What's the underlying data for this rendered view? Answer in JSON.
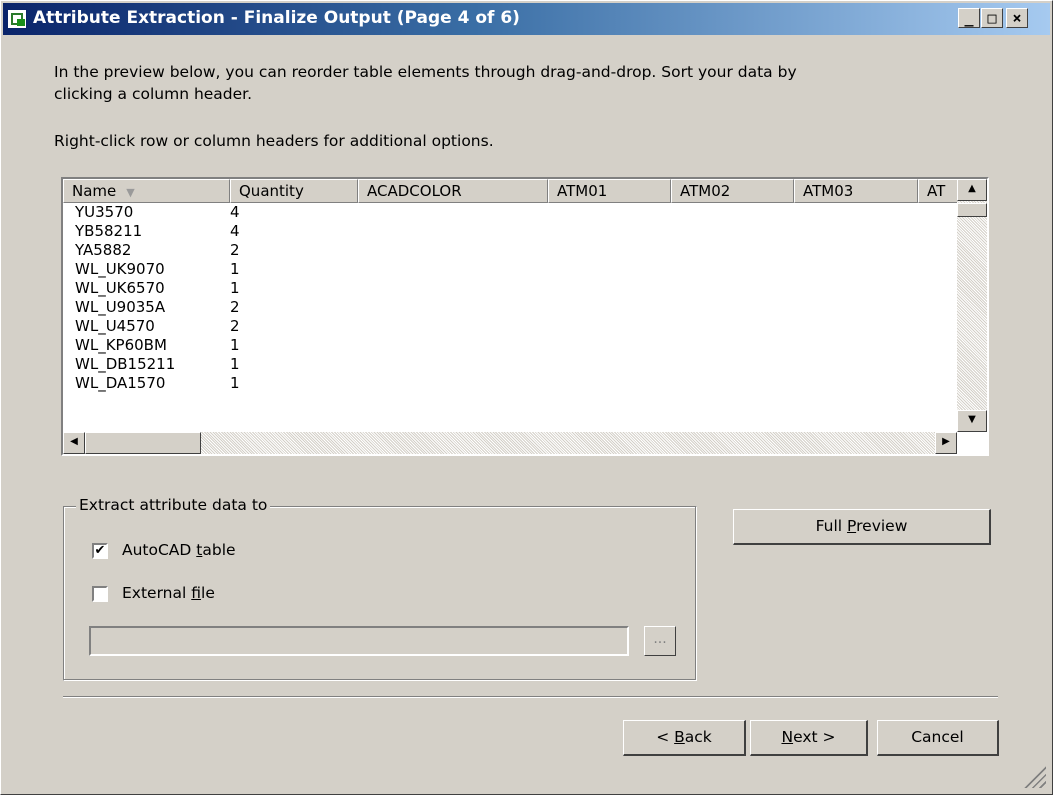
{
  "window": {
    "title": "Attribute Extraction - Finalize Output (Page 4 of 6)",
    "minimize_glyph": "_",
    "maximize_glyph": "□",
    "close_glyph": "×"
  },
  "instructions": {
    "line1": "In the preview below, you can reorder table elements through drag-and-drop. Sort your data by",
    "line2": "clicking a column header.",
    "line3": "Right-click row or column headers for additional options."
  },
  "table": {
    "columns": [
      "Name",
      "Quantity",
      "ACADCOLOR",
      "ATM01",
      "ATM02",
      "ATM03",
      "AT"
    ],
    "sort_indicator": "▼",
    "rows": [
      {
        "name": "YU3570",
        "quantity": "4"
      },
      {
        "name": "YB58211",
        "quantity": "4"
      },
      {
        "name": "YA5882",
        "quantity": "2"
      },
      {
        "name": "WL_UK9070",
        "quantity": "1"
      },
      {
        "name": "WL_UK6570",
        "quantity": "1"
      },
      {
        "name": "WL_U9035A",
        "quantity": "2"
      },
      {
        "name": "WL_U4570",
        "quantity": "2"
      },
      {
        "name": "WL_KP60BM",
        "quantity": "1"
      },
      {
        "name": "WL_DB15211",
        "quantity": "1"
      },
      {
        "name": "WL_DA1570",
        "quantity": "1"
      }
    ]
  },
  "extract": {
    "legend": "Extract attribute data to",
    "autocad_table": {
      "pre": "AutoCAD ",
      "key": "t",
      "post": "able",
      "checked": true
    },
    "external_file": {
      "pre": "External ",
      "key": "f",
      "post": "ile",
      "checked": false
    },
    "path_value": "",
    "browse_label": "..."
  },
  "buttons": {
    "full_preview": {
      "pre": "Full ",
      "key": "P",
      "post": "review"
    },
    "back": {
      "pre": "< ",
      "key": "B",
      "post": "ack"
    },
    "next": {
      "pre": "",
      "key": "N",
      "post": "ext >"
    },
    "cancel": "Cancel"
  },
  "icons": {
    "scroll_up": "▲",
    "scroll_down": "▼",
    "scroll_left": "◀",
    "scroll_right": "▶",
    "check": "✔"
  }
}
